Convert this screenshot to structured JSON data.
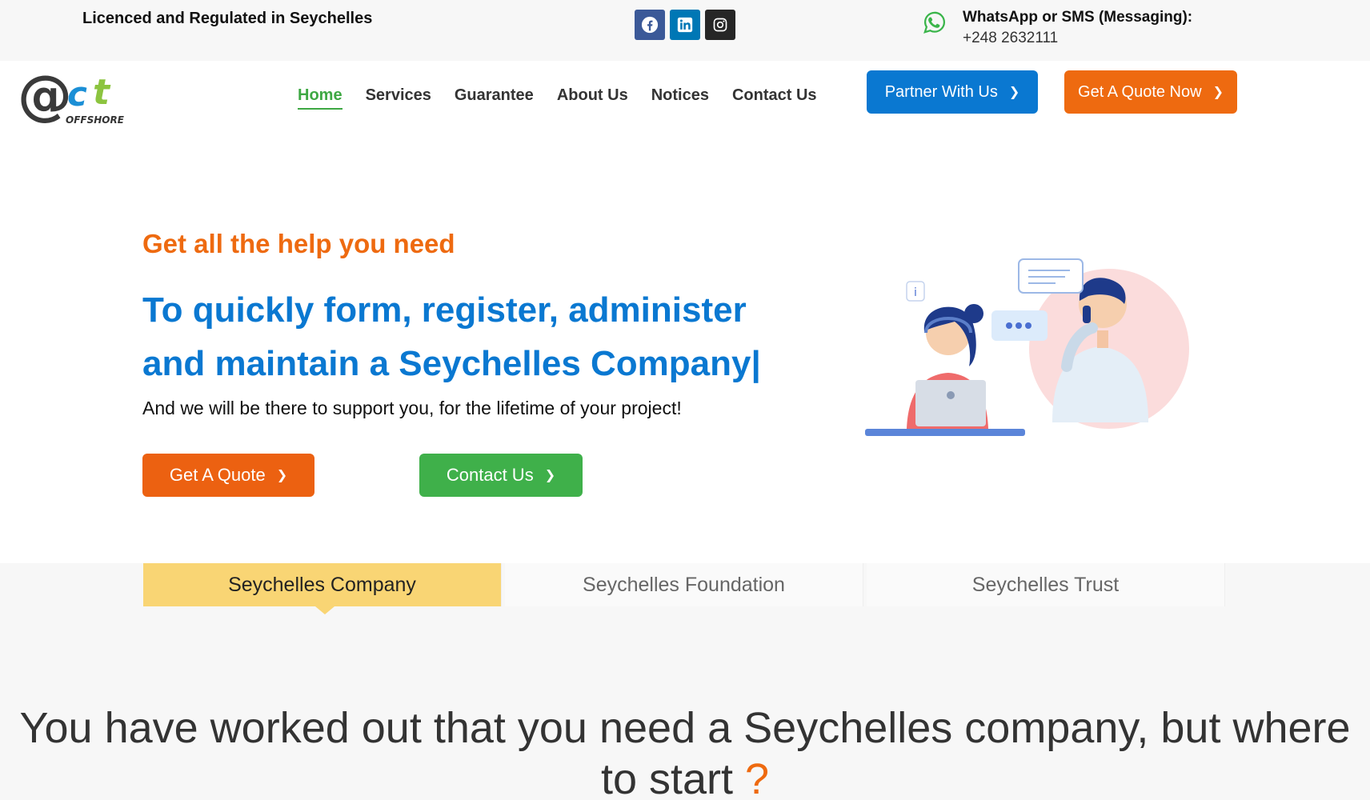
{
  "topbar": {
    "licence": "Licenced and Regulated in Seychelles",
    "social": [
      {
        "icon": "facebook-icon"
      },
      {
        "icon": "linkedin-icon"
      },
      {
        "icon": "instagram-icon"
      }
    ],
    "whatsapp_title": "WhatsApp or SMS (Messaging):",
    "whatsapp_phone": "+248 2632111"
  },
  "logo": {
    "text_at": "@",
    "text_ct": "ct",
    "sub": "OFFSHORE"
  },
  "nav": {
    "items": [
      "Home",
      "Services",
      "Guarantee",
      "About Us",
      "Notices",
      "Contact Us"
    ],
    "active": "Home"
  },
  "header_buttons": {
    "partner": "Partner With Us",
    "quote_now": "Get A Quote Now"
  },
  "hero": {
    "kicker": "Get all the help you need",
    "title": "To quickly form, register, administer and maintain a Seychelles Company|",
    "subtitle": "And we will be there to support you, for the lifetime of your project!",
    "btn_quote": "Get A Quote",
    "btn_contact": "Contact Us"
  },
  "tabs": {
    "items": [
      "Seychelles Company",
      "Seychelles Foundation",
      "Seychelles Trust"
    ],
    "active": "Seychelles Company"
  },
  "section": {
    "heading": "You have worked out that you need a Seychelles company, but where to start",
    "heading_mark": "?"
  },
  "colors": {
    "orange": "#ee6a10",
    "blue": "#0a78d1",
    "green": "#3fb04a",
    "tab_active": "#f9d574"
  }
}
